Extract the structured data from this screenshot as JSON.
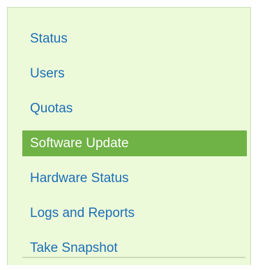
{
  "menu": {
    "items": [
      {
        "label": "Status"
      },
      {
        "label": "Users"
      },
      {
        "label": "Quotas"
      },
      {
        "label": "Software Update",
        "active": true
      },
      {
        "label": "Hardware Status"
      },
      {
        "label": "Logs and Reports"
      },
      {
        "label": "Take Snapshot"
      }
    ]
  },
  "colors": {
    "panel_background": "#edfada",
    "link_text": "#1c6eb6",
    "active_background": "#6fb245",
    "active_text": "#ffffff",
    "divider": "#c9dcb7"
  }
}
